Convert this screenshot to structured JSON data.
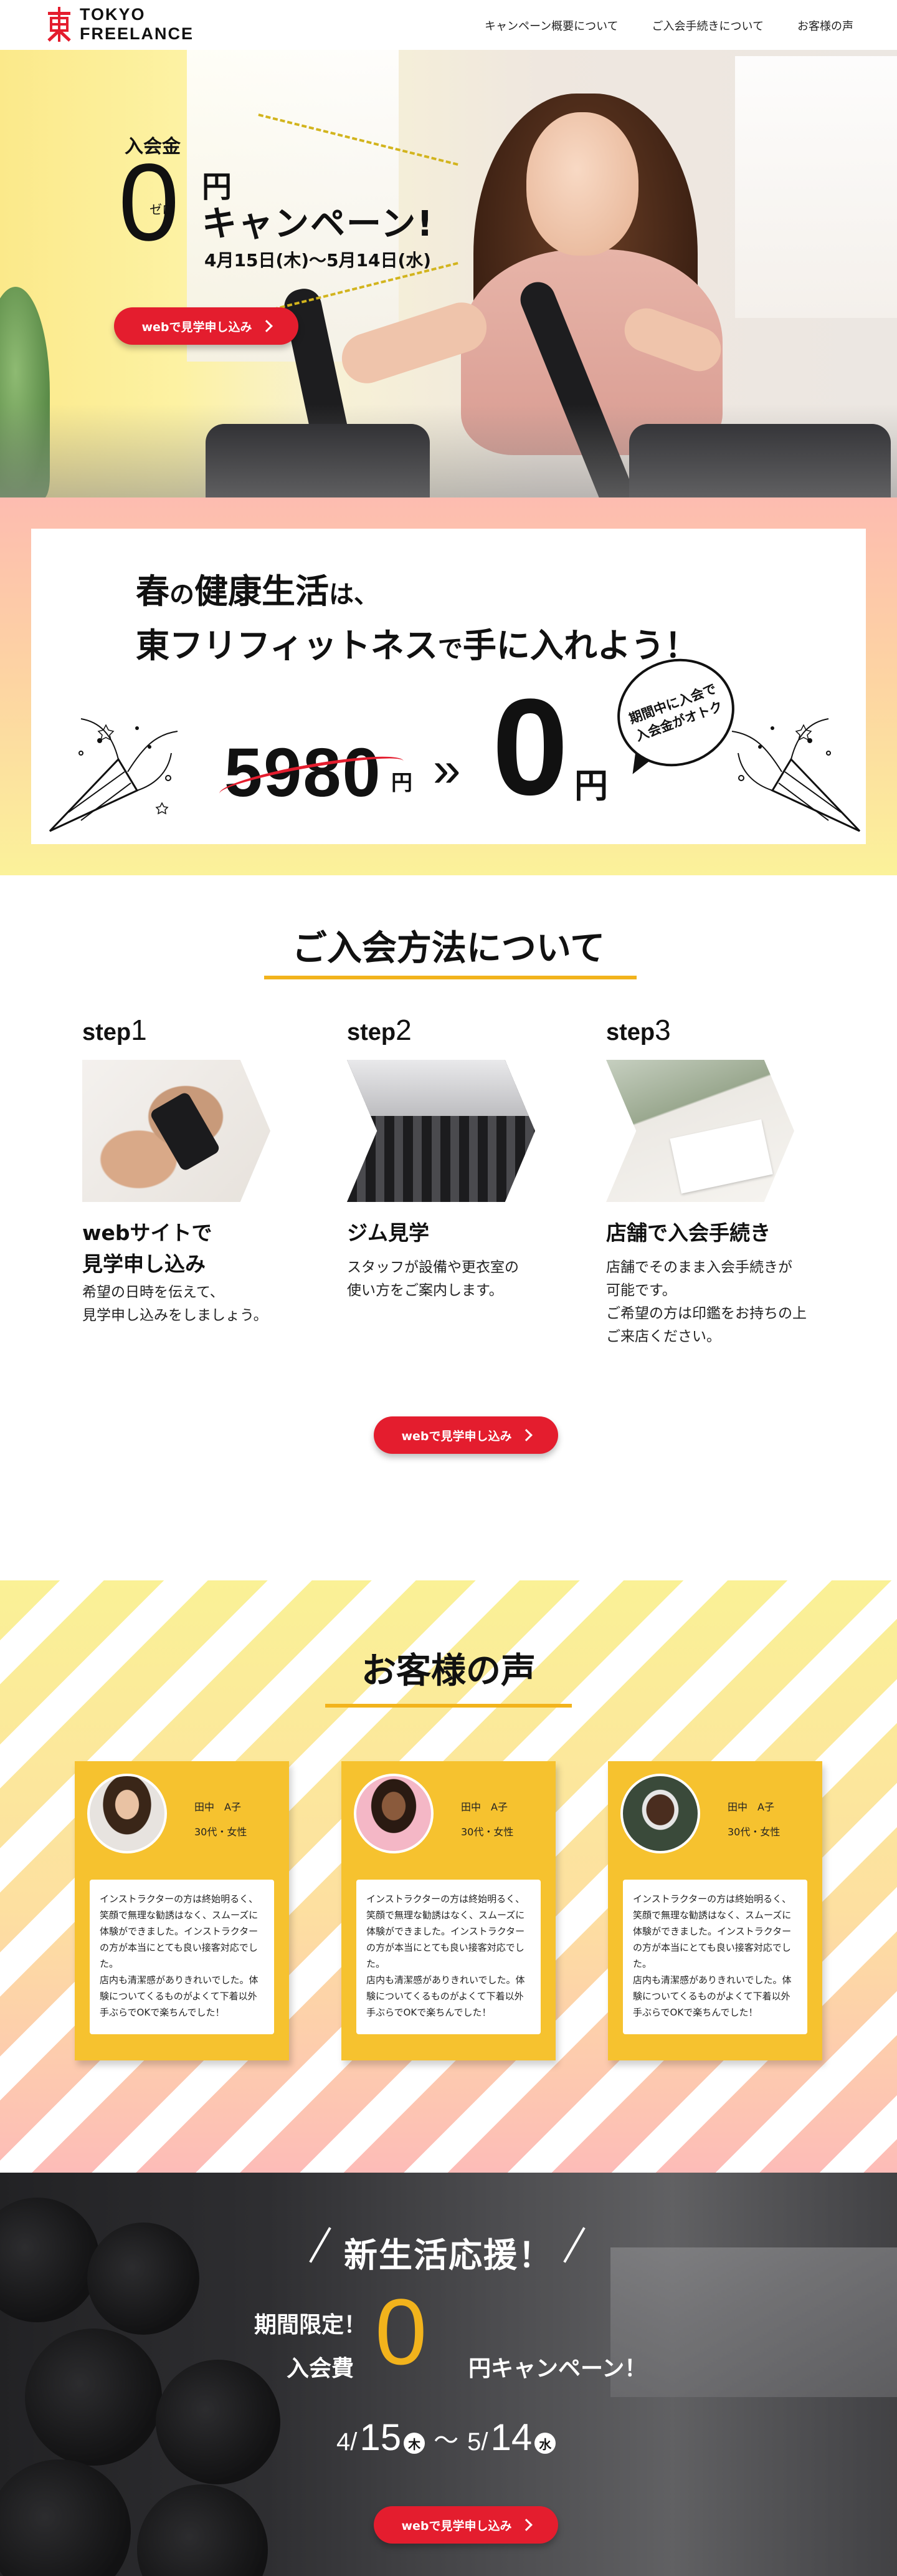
{
  "header": {
    "logo_line1": "TOKYO",
    "logo_line2": "FREELANCE",
    "logo_icon": "tokyo-kanji-logo-icon",
    "nav": [
      "キャンペーン概要について",
      "ご入会手続きについて",
      "お客様の声"
    ]
  },
  "hero": {
    "nyukaikin": "入会金",
    "zero": "0",
    "zero_ruby": "ゼロ",
    "en": "円",
    "campaign": "キャンペーン!",
    "date": "4月15日(木)〜5月14日(水)",
    "cta": "webで見学申し込み"
  },
  "promo": {
    "line1_a": "春",
    "line1_b": "の",
    "line1_c": "健康生活",
    "line1_d": "は、",
    "line2_a": "東フリフィットネス",
    "line2_b": "で",
    "line2_c": "手に入れよう！",
    "old_price": "5980",
    "old_yen": "円",
    "arrows": "»",
    "new_price": "0",
    "new_yen": "円",
    "bubble": "期間中に入会で\n入会金がオトク"
  },
  "steps": {
    "title": "ご入会方法について",
    "items": [
      {
        "label": "step",
        "num": "1",
        "heading1": "webサイトで",
        "heading2": "見学申し込み",
        "text": [
          "希望の日時を伝えて、",
          "見学申し込みをしましょう。"
        ]
      },
      {
        "label": "step",
        "num": "2",
        "heading1": "ジム見学",
        "heading2": "",
        "text": [
          "スタッフが設備や更衣室の",
          "使い方をご案内します。"
        ]
      },
      {
        "label": "step",
        "num": "3",
        "heading1": "店舗で入会手続き",
        "heading2": "",
        "text": [
          "店舗でそのまま入会手続きが",
          "可能です。",
          "ご希望の方は印鑑をお持ちの上",
          "ご来店ください。"
        ]
      }
    ],
    "cta": "webで見学申し込み"
  },
  "voices": {
    "title": "お客様の声",
    "cards": [
      {
        "name": "田中　A子",
        "meta": "30代・女性",
        "text": "インストラクターの方は終始明るく、笑顔で無理な勧誘はなく、スムーズに体験ができました。インストラクターの方が本当にとても良い接客対応でした。\n店内も清潔感がありきれいでした。体験についてくるものがよくて下着以外手ぶらでOKで楽ちんでした！"
      },
      {
        "name": "田中　A子",
        "meta": "30代・女性",
        "text": "インストラクターの方は終始明るく、笑顔で無理な勧誘はなく、スムーズに体験ができました。インストラクターの方が本当にとても良い接客対応でした。\n店内も清潔感がありきれいでした。体験についてくるものがよくて下着以外手ぶらでOKで楽ちんでした！"
      },
      {
        "name": "田中　A子",
        "meta": "30代・女性",
        "text": "インストラクターの方は終始明るく、笑顔で無理な勧誘はなく、スムーズに体験ができました。インストラクターの方が本当にとても良い接客対応でした。\n店内も清潔感がありきれいでした。体験についてくるものがよくて下着以外手ぶらでOKで楽ちんでした！"
      }
    ]
  },
  "final": {
    "title": "新生活応援！",
    "line1": "期間限定！",
    "line2": "入会費",
    "zero": "0",
    "campaign": "円キャンペーン！",
    "date_m1": "4/",
    "date_d1": "15",
    "wd1": "木",
    "tilde": "〜",
    "date_m2": "5/",
    "date_d2": "14",
    "wd2": "水",
    "cta": "webで見学申し込み"
  },
  "colors": {
    "accent_red": "#e41d2e",
    "accent_yellow": "#f2b31c",
    "card_yellow": "#f6c22f"
  }
}
